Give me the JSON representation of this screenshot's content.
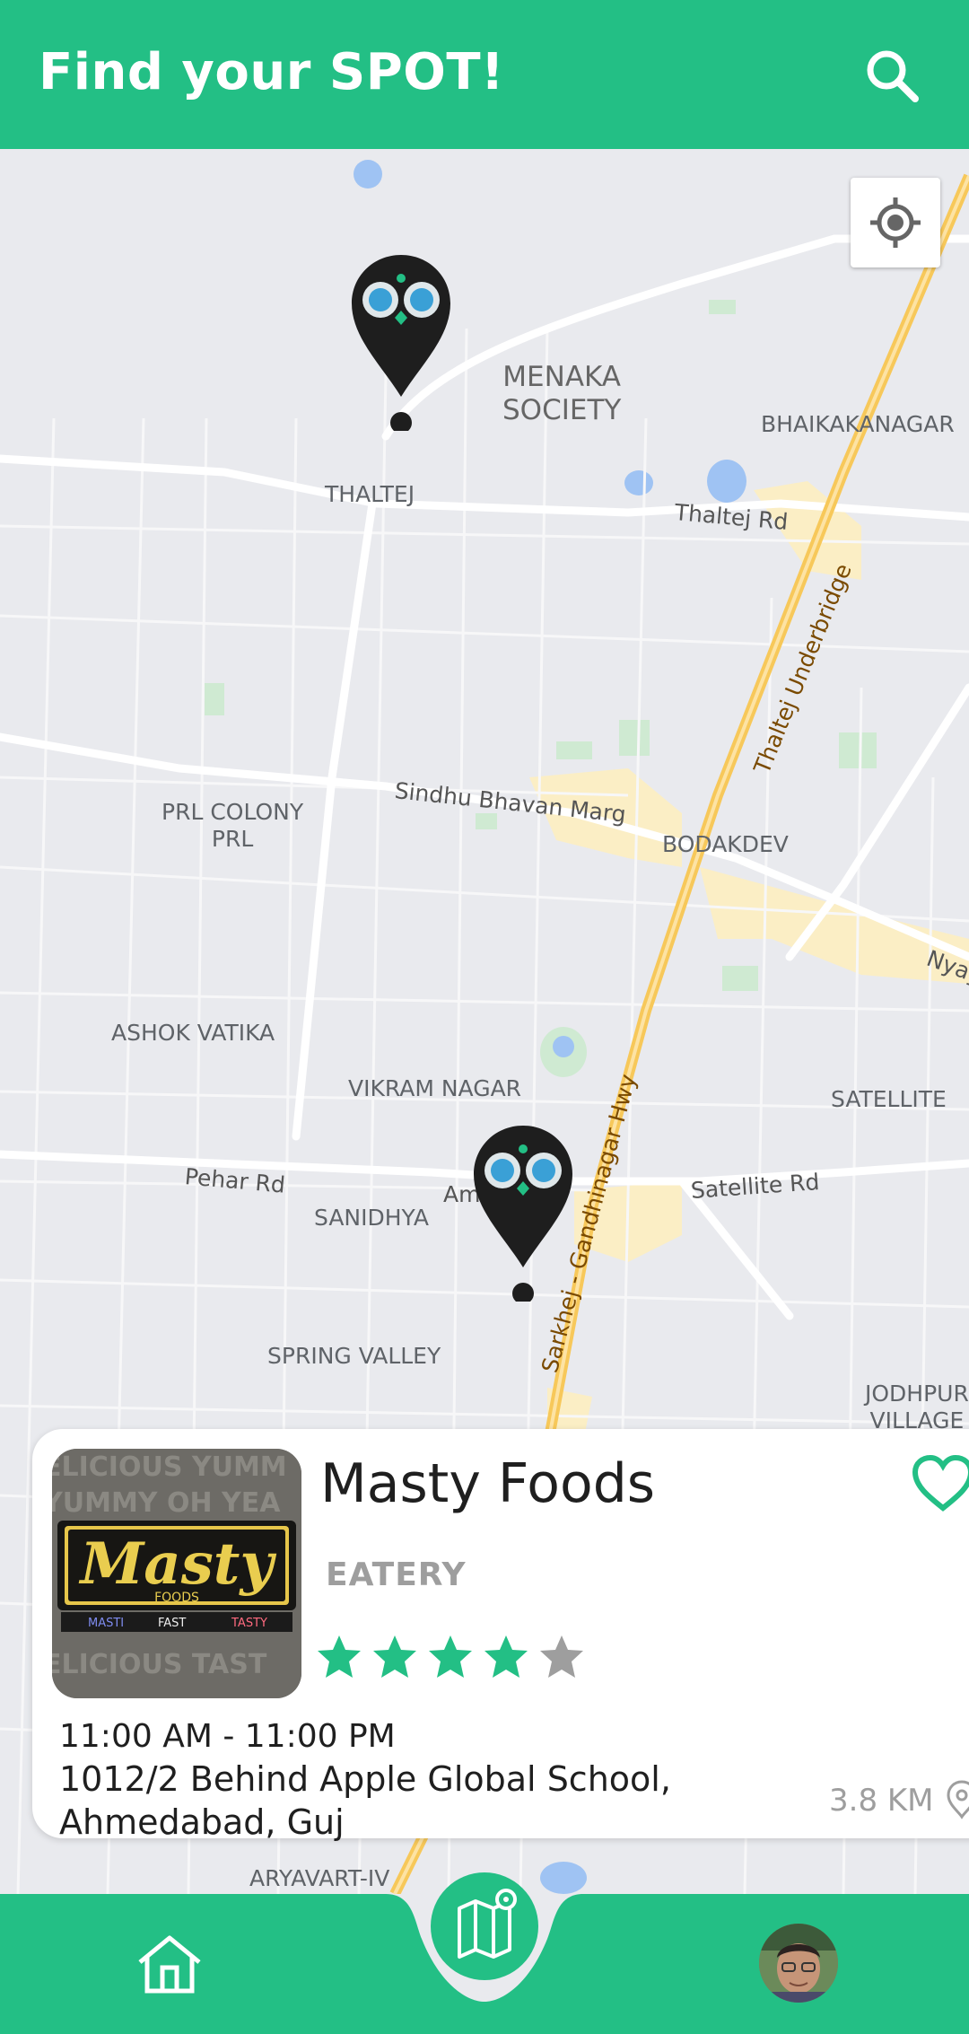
{
  "app_bar": {
    "title": "Find your SPOT!",
    "search_icon": "search-icon",
    "background_color": "#23bf85"
  },
  "map": {
    "labels": {
      "menaka_society": "MENAKA\nSOCIETY",
      "bhaikakanagar": "BHAIKAKANAGAR",
      "thaltej": "THALTEJ",
      "thaltej_rd": "Thaltej Rd",
      "thaltej_underbridge": "Thaltej Underbridge",
      "prl_colony": "PRL COLONY\nPRL",
      "sindhu_bhavan_marg": "Sindhu Bhavan Marg",
      "bodakdev": "BODAKDEV",
      "nyay": "Nyay",
      "ashok_vatika": "ASHOK VATIKA",
      "vikram_nagar": "VIKRAM NAGAR",
      "satellite": "SATELLITE",
      "pehar_rd": "Pehar Rd",
      "am": "Am",
      "sanidhya": "SANIDHYA",
      "satellite_rd": "Satellite Rd",
      "sg_highway": "Sarkhej - Gandhinagar Hwy",
      "spring_valley": "SPRING VALLEY",
      "jodhpur_village": "JODHPUR\nVILLAGE",
      "aryavart": "ARYAVART-IV"
    },
    "locate_icon": "my-location-icon",
    "pins": [
      "spot-pin",
      "spot-pin"
    ]
  },
  "spot": {
    "name": "Masty Foods",
    "category": "EATERY",
    "rating": 4,
    "rating_max": 5,
    "hours": "11:00 AM - 11:00 PM",
    "address": "1012/2 Behind Apple Global School,\nAhmedabad, Guj",
    "distance": "3.8 KM",
    "thumb": {
      "logo_main": "Masty",
      "logo_sub": "FOODS",
      "tagline_1": "MASTI",
      "tagline_2": "FAST",
      "tagline_3": "TASTY"
    },
    "accent_color": "#23bf85",
    "star_off_color": "#9e9e9e"
  },
  "bottom_nav": {
    "home_icon": "home-icon",
    "map_icon": "map-icon",
    "avatar": "profile-avatar"
  }
}
